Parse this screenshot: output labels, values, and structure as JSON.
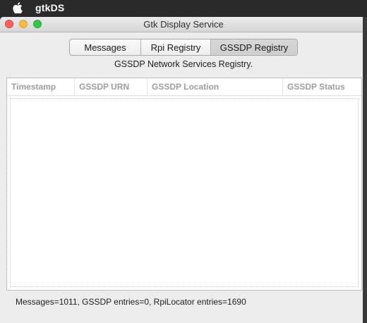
{
  "menubar": {
    "app_name": "gtkDS"
  },
  "window": {
    "title": "Gtk Display Service"
  },
  "tabs": [
    {
      "label": "Messages",
      "selected": false
    },
    {
      "label": "Rpi Registry",
      "selected": false
    },
    {
      "label": "GSSDP Registry",
      "selected": true
    }
  ],
  "panel": {
    "subtitle": "GSSDP Network Services Registry."
  },
  "table": {
    "columns": [
      "Timestamp",
      "GSSDP URN",
      "GSSDP Location",
      "GSSDP Status"
    ],
    "rows": []
  },
  "status": {
    "text": "Messages=1011, GSSDP entries=0, RpiLocator entries=1690"
  },
  "colors": {
    "close": "#fc605c",
    "minimize": "#fdbc40",
    "maximize": "#34c84a"
  }
}
